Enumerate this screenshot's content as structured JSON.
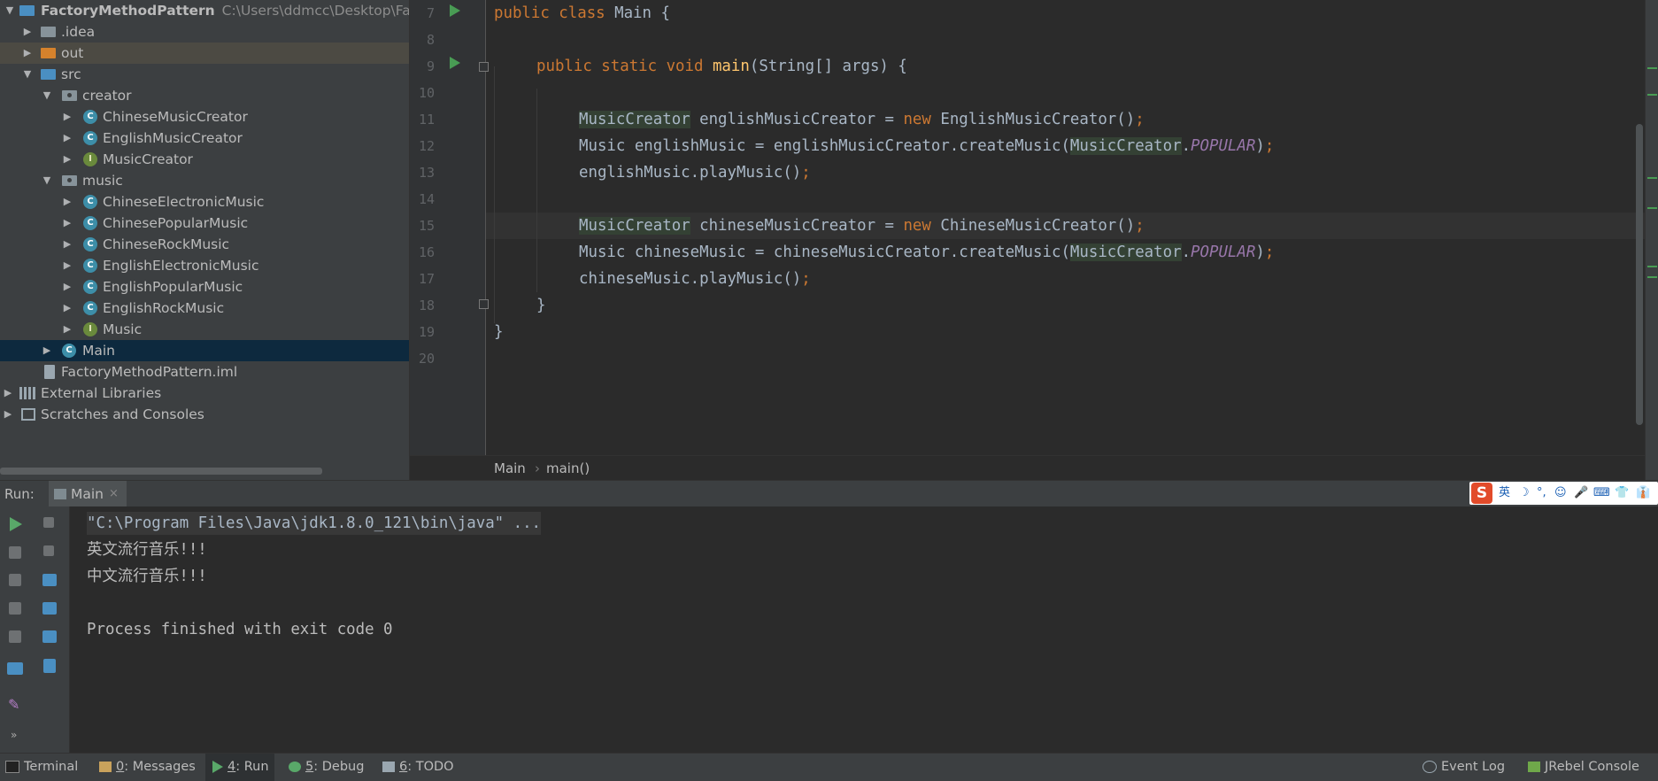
{
  "project": {
    "root_name": "FactoryMethodPattern",
    "root_path": "C:\\Users\\ddmcc\\Desktop\\Factor",
    "items": {
      "idea": ".idea",
      "out": "out",
      "src": "src",
      "creator": "creator",
      "chinese_music_creator": "ChineseMusicCreator",
      "english_music_creator": "EnglishMusicCreator",
      "music_creator": "MusicCreator",
      "music": "music",
      "chinese_electronic_music": "ChineseElectronicMusic",
      "chinese_popular_music": "ChinesePopularMusic",
      "chinese_rock_music": "ChineseRockMusic",
      "english_electronic_music": "EnglishElectronicMusic",
      "english_popular_music": "EnglishPopularMusic",
      "english_rock_music": "EnglishRockMusic",
      "music_interface": "Music",
      "main": "Main",
      "iml": "FactoryMethodPattern.iml",
      "external_libraries": "External Libraries",
      "scratches": "Scratches and Consoles"
    },
    "class_icon_letter": "C",
    "interface_icon_letter": "I"
  },
  "editor": {
    "line_numbers": [
      "7",
      "8",
      "9",
      "10",
      "11",
      "12",
      "13",
      "14",
      "15",
      "16",
      "17",
      "18",
      "19",
      "20"
    ],
    "code": {
      "l7_kw": "public class",
      "l7_rest": " Main {",
      "l9_kw1": "public static void",
      "l9_fn": "main",
      "l9_rest": "(String[] args) {",
      "l11_type": "MusicCreator",
      "l11_mid": " englishMusicCreator = ",
      "l11_new": "new",
      "l11_rest": " EnglishMusicCreator()",
      "l12_start": "Music englishMusic = englishMusicCreator.createMusic(",
      "l12_type": "MusicCreator",
      "l12_dot": ".",
      "l12_const": "POPULAR",
      "l12_end": ")",
      "l13": "englishMusic.playMusic()",
      "l15_type": "MusicCreator",
      "l15_mid": " chineseMusicCreator = ",
      "l15_new": "new",
      "l15_rest": " ChineseMusicCreator()",
      "l16_start": "Music chineseMusic = chineseMusicCreator.createMusic(",
      "l16_type": "MusicCreator",
      "l16_dot": ".",
      "l16_const": "POPULAR",
      "l16_end": ")",
      "l17": "chineseMusic.playMusic()",
      "l18": "}",
      "l19": "}",
      "semicolon": ";"
    },
    "breadcrumb": [
      "Main",
      "main()"
    ],
    "breadcrumb_sep": "›"
  },
  "run": {
    "label": "Run:",
    "tab": "Main",
    "tab_close": "×",
    "console": [
      "\"C:\\Program Files\\Java\\jdk1.8.0_121\\bin\\java\" ...",
      "英文流行音乐!!!",
      "中文流行音乐!!!",
      "",
      "Process finished with exit code 0"
    ]
  },
  "ime": {
    "logo": "S",
    "lang": "英",
    "moon": "☽",
    "punct": "°,",
    "smile": "☺",
    "mic": "🎤",
    "keyboard": "⌨",
    "skin": "👕",
    "more": "👔"
  },
  "statusbar": {
    "terminal": "Terminal",
    "messages_num": "0",
    "messages": ": Messages",
    "run_num": "4",
    "run": ": Run",
    "debug_num": "5",
    "debug": ": Debug",
    "todo_num": "6",
    "todo": ": TODO",
    "event_log": "Event Log",
    "jrebel": "JRebel Console"
  },
  "colors": {
    "keyword": "#cc7832",
    "function": "#ffc66d",
    "constant": "#9876aa",
    "run_green": "#499c54",
    "selection": "#0d293e"
  }
}
